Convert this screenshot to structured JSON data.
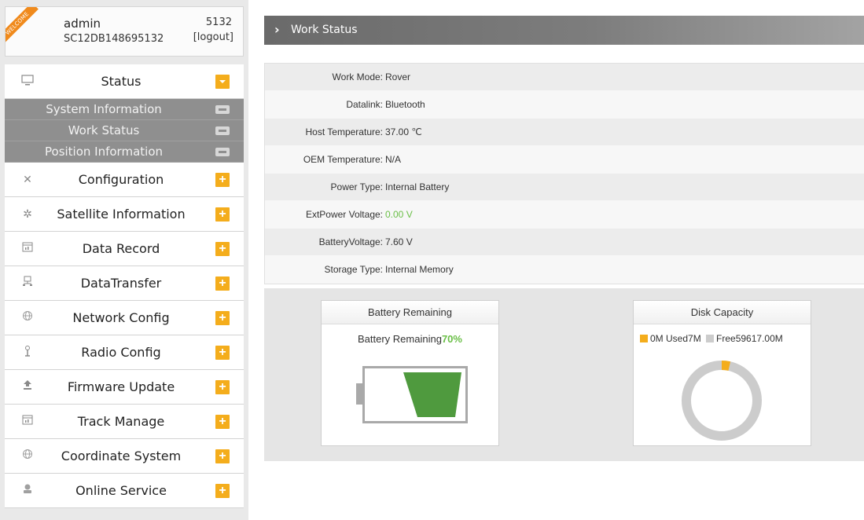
{
  "user": {
    "badge": "WELCOME",
    "name": "admin",
    "serial": "SC12DB148695132",
    "code": "5132",
    "logout": "[logout]"
  },
  "menu": {
    "status": "Status",
    "sub_system_info": "System Information",
    "sub_work_status": "Work Status",
    "sub_position_info": "Position Information",
    "configuration": "Configuration",
    "satellite_info": "Satellite Information",
    "data_record": "Data Record",
    "data_transfer": "DataTransfer",
    "network_config": "Network Config",
    "radio_config": "Radio Config",
    "firmware_update": "Firmware Update",
    "track_manage": "Track Manage",
    "coordinate_system": "Coordinate System",
    "online_service": "Online Service"
  },
  "page": {
    "title": "Work Status"
  },
  "status": {
    "rows": [
      {
        "key": "Work Mode:",
        "value": "Rover"
      },
      {
        "key": "Datalink:",
        "value": "Bluetooth"
      },
      {
        "key": "Host Temperature:",
        "value": "37.00 ℃"
      },
      {
        "key": "OEM Temperature:",
        "value": "N/A"
      },
      {
        "key": "Power Type:",
        "value": "Internal Battery"
      },
      {
        "key": "ExtPower Voltage:",
        "value": "0.00 V"
      },
      {
        "key": "BatteryVoltage:",
        "value": "7.60 V"
      },
      {
        "key": "Storage Type:",
        "value": "Internal Memory"
      }
    ]
  },
  "battery": {
    "title": "Battery Remaining",
    "label": "Battery Remaining",
    "percent_text": "70%",
    "percent": 70
  },
  "disk": {
    "title": "Disk Capacity",
    "legend_used": "0M Used7M",
    "legend_free": "Free59617.00M",
    "used_mb": 7,
    "free_mb": 59617.0
  },
  "colors": {
    "accent": "#f4ad1c",
    "green": "#6abf47",
    "used": "#f4ad1c",
    "free": "#cccccc"
  },
  "icons": {
    "status": "monitor-icon",
    "configuration": "tools-icon",
    "satellite": "satellite-icon",
    "data_record": "calendar-icon",
    "data_transfer": "network-icon",
    "network_config": "globe-icon",
    "radio_config": "antenna-icon",
    "firmware_update": "upload-icon",
    "track_manage": "calendar-icon",
    "coordinate_system": "globe-icon",
    "online_service": "service-icon"
  }
}
